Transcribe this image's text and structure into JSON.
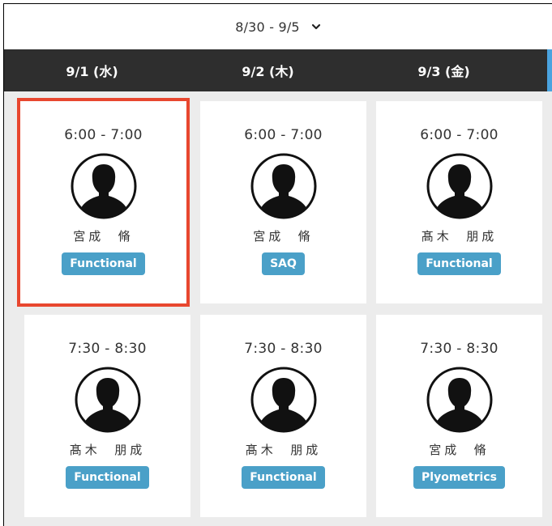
{
  "week": {
    "label": "8/30 - 9/5"
  },
  "days": [
    "9/1 (水)",
    "9/2 (木)",
    "9/3 (金)"
  ],
  "sessions": [
    {
      "time": "6:00 - 7:00",
      "trainer": "宮成  脩",
      "tag": "Functional",
      "selected": true
    },
    {
      "time": "6:00 - 7:00",
      "trainer": "宮成  脩",
      "tag": "SAQ"
    },
    {
      "time": "6:00 - 7:00",
      "trainer": "髙木  朋成",
      "tag": "Functional"
    },
    {
      "time": "7:30 - 8:30",
      "trainer": "髙木  朋成",
      "tag": "Functional"
    },
    {
      "time": "7:30 - 8:30",
      "trainer": "髙木  朋成",
      "tag": "Functional"
    },
    {
      "time": "7:30 - 8:30",
      "trainer": "宮成  脩",
      "tag": "Plyometrics"
    }
  ],
  "colors": {
    "header_bg": "#2e2e2e",
    "tag_bg": "#4aa0c8",
    "selected_outline": "#e8472f",
    "grid_bg": "#ececec"
  },
  "icons": {
    "week_dropdown": "chevron-down-icon",
    "trainer_avatar": "avatar-silhouette-icon"
  }
}
